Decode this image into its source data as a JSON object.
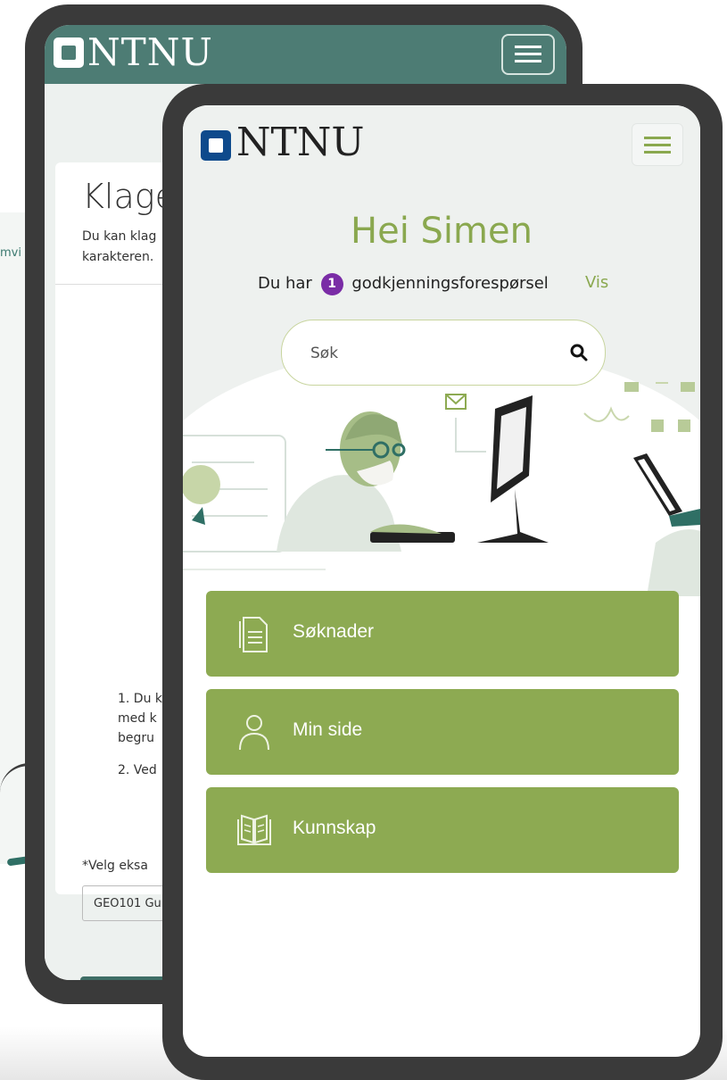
{
  "back_page": {
    "left_peek_text": "mvi",
    "logo_text": "NTNU",
    "title": "Klage",
    "subtitle_lines": [
      "Du kan klag",
      "karakteren."
    ],
    "list_items": [
      [
        "1. Du k",
        "med k",
        "begru"
      ],
      [
        "2. Ved"
      ]
    ],
    "required_mark": "*",
    "exam_label": "Velg eksa",
    "exam_select_value": "GEO101 Gu"
  },
  "front_page": {
    "logo_text": "NTNU",
    "greeting": "Hei Simen",
    "approval_prefix": "Du har",
    "approval_count": "1",
    "approval_suffix": "godkjenningsforespørsel",
    "view_link": "Vis",
    "search_placeholder": "Søk",
    "nav": [
      {
        "label": "Søknader",
        "icon": "document-icon"
      },
      {
        "label": "Min side",
        "icon": "user-icon"
      },
      {
        "label": "Kunnskap",
        "icon": "book-icon"
      }
    ]
  },
  "colors": {
    "brand_green": "#8daa52",
    "back_header": "#4d7c74",
    "badge": "#7a2ca6",
    "logo_blue": "#0e4a8c",
    "phone_frame": "#3a3a3a"
  }
}
